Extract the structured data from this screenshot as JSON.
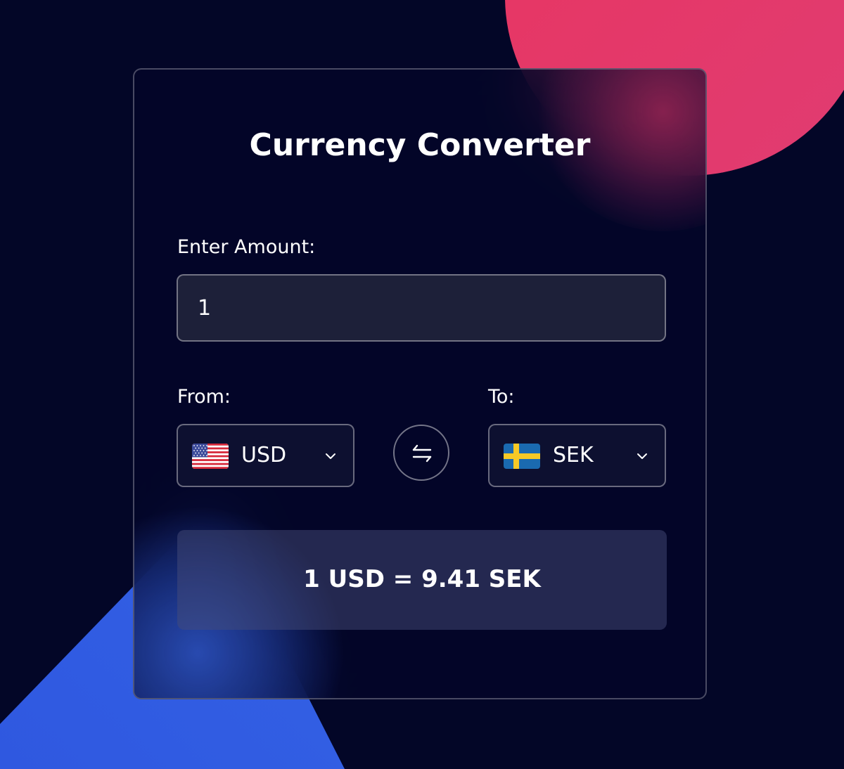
{
  "title": "Currency Converter",
  "amount": {
    "label": "Enter Amount:",
    "value": "1"
  },
  "from": {
    "label": "From:",
    "currency": "USD",
    "flag_icon": "us-flag-icon"
  },
  "to": {
    "label": "To:",
    "currency": "SEK",
    "flag_icon": "sweden-flag-icon"
  },
  "swap_icon": "swap-arrows-icon",
  "result": "1 USD = 9.41 SEK",
  "colors": {
    "background": "#030627",
    "accent_pink": "#e23766",
    "accent_blue": "#3168e8",
    "card_border": "rgba(255,255,255,0.28)"
  }
}
